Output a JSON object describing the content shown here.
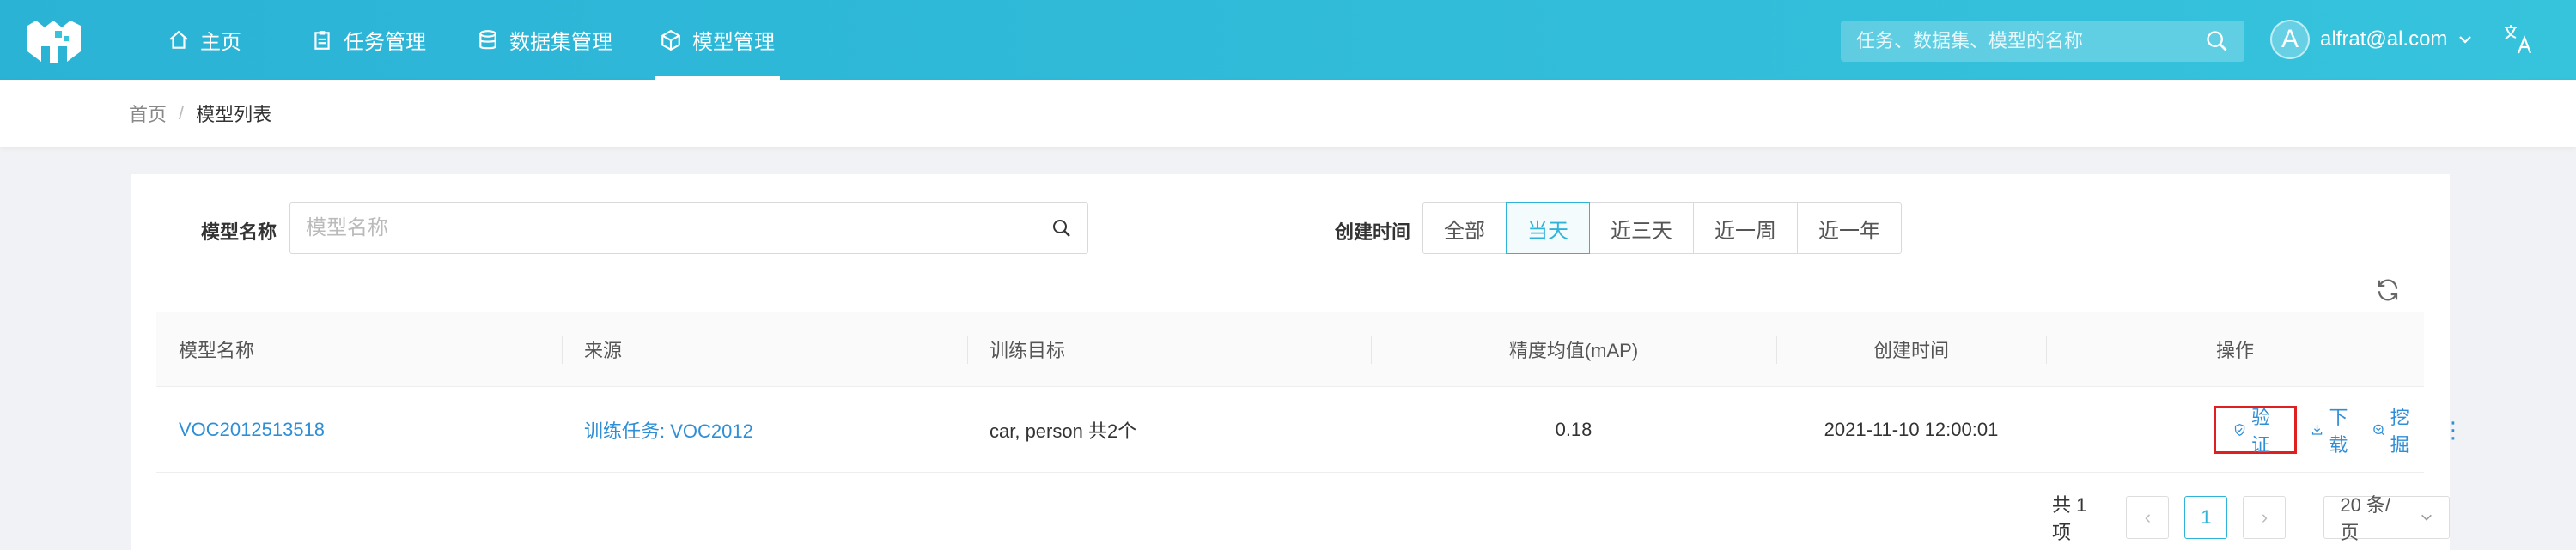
{
  "header": {
    "nav": [
      {
        "label": "主页",
        "icon": "home-icon"
      },
      {
        "label": "任务管理",
        "icon": "clipboard-icon"
      },
      {
        "label": "数据集管理",
        "icon": "database-icon"
      },
      {
        "label": "模型管理",
        "icon": "cube-icon",
        "active": true
      }
    ],
    "search_placeholder": "任务、数据集、模型的名称",
    "user_initial": "A",
    "user_email": "alfrat@al.com"
  },
  "breadcrumb": {
    "home": "首页",
    "separator": "/",
    "current": "模型列表"
  },
  "filters": {
    "name_label": "模型名称",
    "name_placeholder": "模型名称",
    "time_label": "创建时间",
    "time_options": [
      "全部",
      "当天",
      "近三天",
      "近一周",
      "近一年"
    ],
    "time_selected": "当天"
  },
  "table": {
    "columns": [
      "模型名称",
      "来源",
      "训练目标",
      "精度均值(mAP)",
      "创建时间",
      "操作"
    ],
    "rows": [
      {
        "name": "VOC2012513518",
        "source": "训练任务: VOC2012",
        "target": "car, person 共2个",
        "map": "0.18",
        "created": "2021-11-10 12:00:01",
        "actions": {
          "verify": "验证",
          "download": "下载",
          "mine": "挖掘"
        }
      }
    ]
  },
  "pagination": {
    "total": "共 1 项",
    "current_page": "1",
    "page_size": "20 条/页"
  },
  "colors": {
    "header": "#36c3dc",
    "accent": "#2fb3d8",
    "link": "#2f8fd6",
    "highlight": "#e02020"
  }
}
